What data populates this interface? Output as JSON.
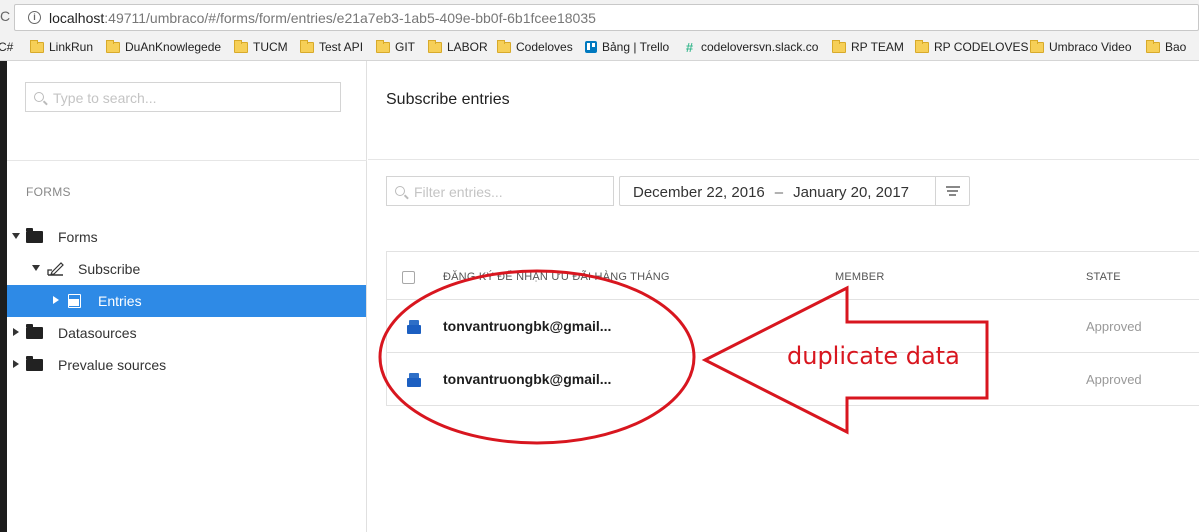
{
  "browser": {
    "url_host": "localhost",
    "url_rest": ":49711/umbraco/#/forms/form/entries/e21a7eb3-1ab5-409e-bb0f-6b1fcee18035",
    "bookmarks": [
      {
        "label": "C#",
        "icon": "folder-icon"
      },
      {
        "label": "LinkRun",
        "icon": "folder-icon"
      },
      {
        "label": "DuAnKnowlegede",
        "icon": "folder-icon"
      },
      {
        "label": "TUCM",
        "icon": "folder-icon"
      },
      {
        "label": "Test API",
        "icon": "folder-icon"
      },
      {
        "label": "GIT",
        "icon": "folder-icon"
      },
      {
        "label": "LABOR",
        "icon": "folder-icon"
      },
      {
        "label": "Codeloves",
        "icon": "folder-icon"
      },
      {
        "label": "Bảng | Trello",
        "icon": "trello-icon"
      },
      {
        "label": "codeloversvn.slack.co",
        "icon": "slack-icon"
      },
      {
        "label": "RP TEAM",
        "icon": "folder-icon"
      },
      {
        "label": "RP CODELOVES",
        "icon": "folder-icon"
      },
      {
        "label": "Umbraco Video",
        "icon": "folder-icon"
      },
      {
        "label": "Bao",
        "icon": "folder-icon"
      }
    ]
  },
  "tree": {
    "search_placeholder": "Type to search...",
    "heading": "FORMS",
    "nodes": [
      {
        "label": "Forms"
      },
      {
        "label": "Subscribe"
      },
      {
        "label": "Entries"
      },
      {
        "label": "Datasources"
      },
      {
        "label": "Prevalue sources"
      }
    ]
  },
  "main": {
    "title": "Subscribe entries",
    "filter_placeholder": "Filter entries...",
    "date_from": "December 22, 2016",
    "date_sep": "–",
    "date_to": "January 20, 2017",
    "columns": [
      "ĐĂNG KÝ ĐỂ NHẬN ƯU ĐÃI HÀNG THÁNG",
      "MEMBER",
      "STATE"
    ],
    "rows": [
      {
        "email": "tonvantruongbk@gmail...",
        "member": "",
        "state": "Approved"
      },
      {
        "email": "tonvantruongbk@gmail...",
        "member": "",
        "state": "Approved"
      }
    ]
  },
  "annotation": {
    "text": "duplicate data",
    "color": "#d8161f"
  }
}
